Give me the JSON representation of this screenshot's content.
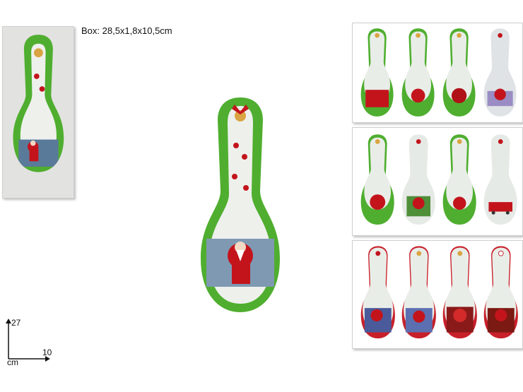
{
  "box_label": "Box: 28,5x1,8x10,5cm",
  "scale": {
    "height_value": "27",
    "width_value": "10",
    "unit": "cm"
  },
  "colors": {
    "green_border": "#4fae2f",
    "red_border": "#c8202a",
    "body_white": "#eef0ec",
    "santa_red": "#c3141c"
  },
  "products": {
    "main": "green-holly-santa",
    "row1": [
      "green-gifts",
      "green-santa-children",
      "green-santa-sleigh",
      "white-santa-lilac"
    ],
    "row2": [
      "green-santa-sack",
      "white-santa-tree",
      "green-santa-tree",
      "white-red-truck"
    ],
    "row3": [
      "red-santa-tree-night",
      "red-santa-village",
      "red-santa-list",
      "red-santa-toys"
    ]
  }
}
